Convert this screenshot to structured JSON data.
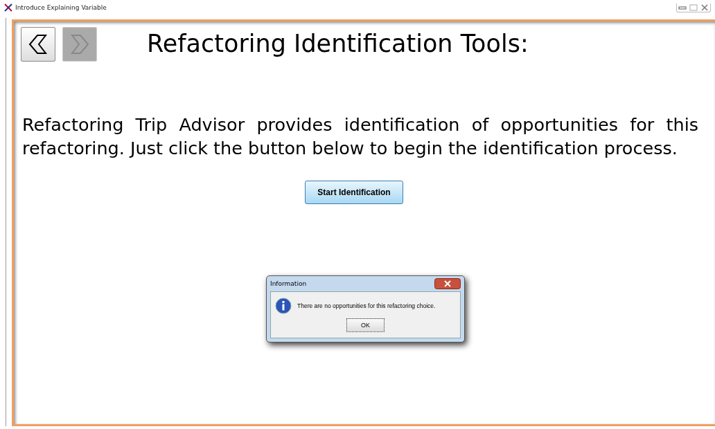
{
  "window": {
    "title": "Introduce Explaining Variable"
  },
  "nav_buttons": [
    {
      "kind": "back",
      "disabled": false
    },
    {
      "kind": "forward",
      "disabled": true
    }
  ],
  "heading": "Refactoring Identification Tools:",
  "description": "Refactoring Trip Advisor provides identification of opportunities for this refactoring. Just click the button below to begin the identification process.",
  "start_button": "Start Identification",
  "dialog": {
    "title": "Information",
    "message": "There are no opportunities for this refactoring choice.",
    "button": "OK"
  }
}
